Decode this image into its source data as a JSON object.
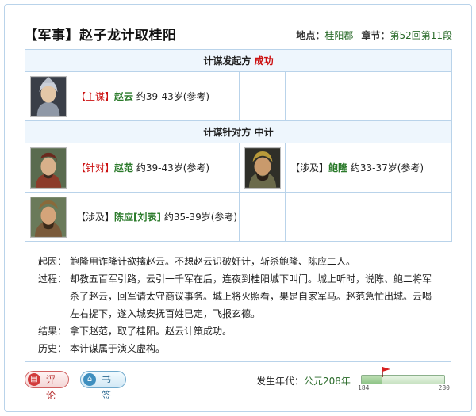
{
  "title": "【军事】赵子龙计取桂阳",
  "meta": {
    "location_label": "地点：",
    "location_value": "桂阳郡",
    "chapter_label": "章节：",
    "chapter_value": "第52回第11段"
  },
  "initiator": {
    "header_label": "计谋发起方",
    "header_result": "成功",
    "person": {
      "role": "【主谋】",
      "name": "赵云",
      "age": "约39-43岁(参考)"
    }
  },
  "target": {
    "header_label": "计谋针对方",
    "header_result": "中计",
    "people": [
      {
        "role": "【针对】",
        "name": "赵范",
        "age": "约39-43岁(参考)"
      },
      {
        "role": "【涉及】",
        "name": "鲍隆",
        "age": "约33-37岁(参考)"
      },
      {
        "role": "【涉及】",
        "name": "陈应[刘表]",
        "age": "约35-39岁(参考)"
      }
    ]
  },
  "description": {
    "cause_label": "起因：",
    "cause": "鲍隆用诈降计欲擒赵云。不想赵云识破奸计，斩杀鲍隆、陈应二人。",
    "process_label": "过程：",
    "process": "却教五百军引路，云引一千军在后，连夜到桂阳城下叫门。城上听时，说陈、鲍二将军杀了赵云，回军请太守商议事务。城上将火照看，果是自家军马。赵范急忙出城。云喝左右捉下，遂入城安抚百姓已定，飞报玄德。",
    "result_label": "结果：",
    "result": "拿下赵范，取了桂阳。赵云计策成功。",
    "history_label": "历史：",
    "history": "本计谋属于演义虚构。"
  },
  "footer": {
    "comment_label": "评论",
    "bookmark_label": "书签",
    "era_label": "发生年代：",
    "era_value": "公元208年",
    "slider_min": "184",
    "slider_max": "280",
    "slider_value": 208
  },
  "colors": {
    "border": "#b9d3ea",
    "header_bg": "#eef6fd",
    "accent_red": "#cc1111",
    "accent_green": "#2a7a2a"
  }
}
